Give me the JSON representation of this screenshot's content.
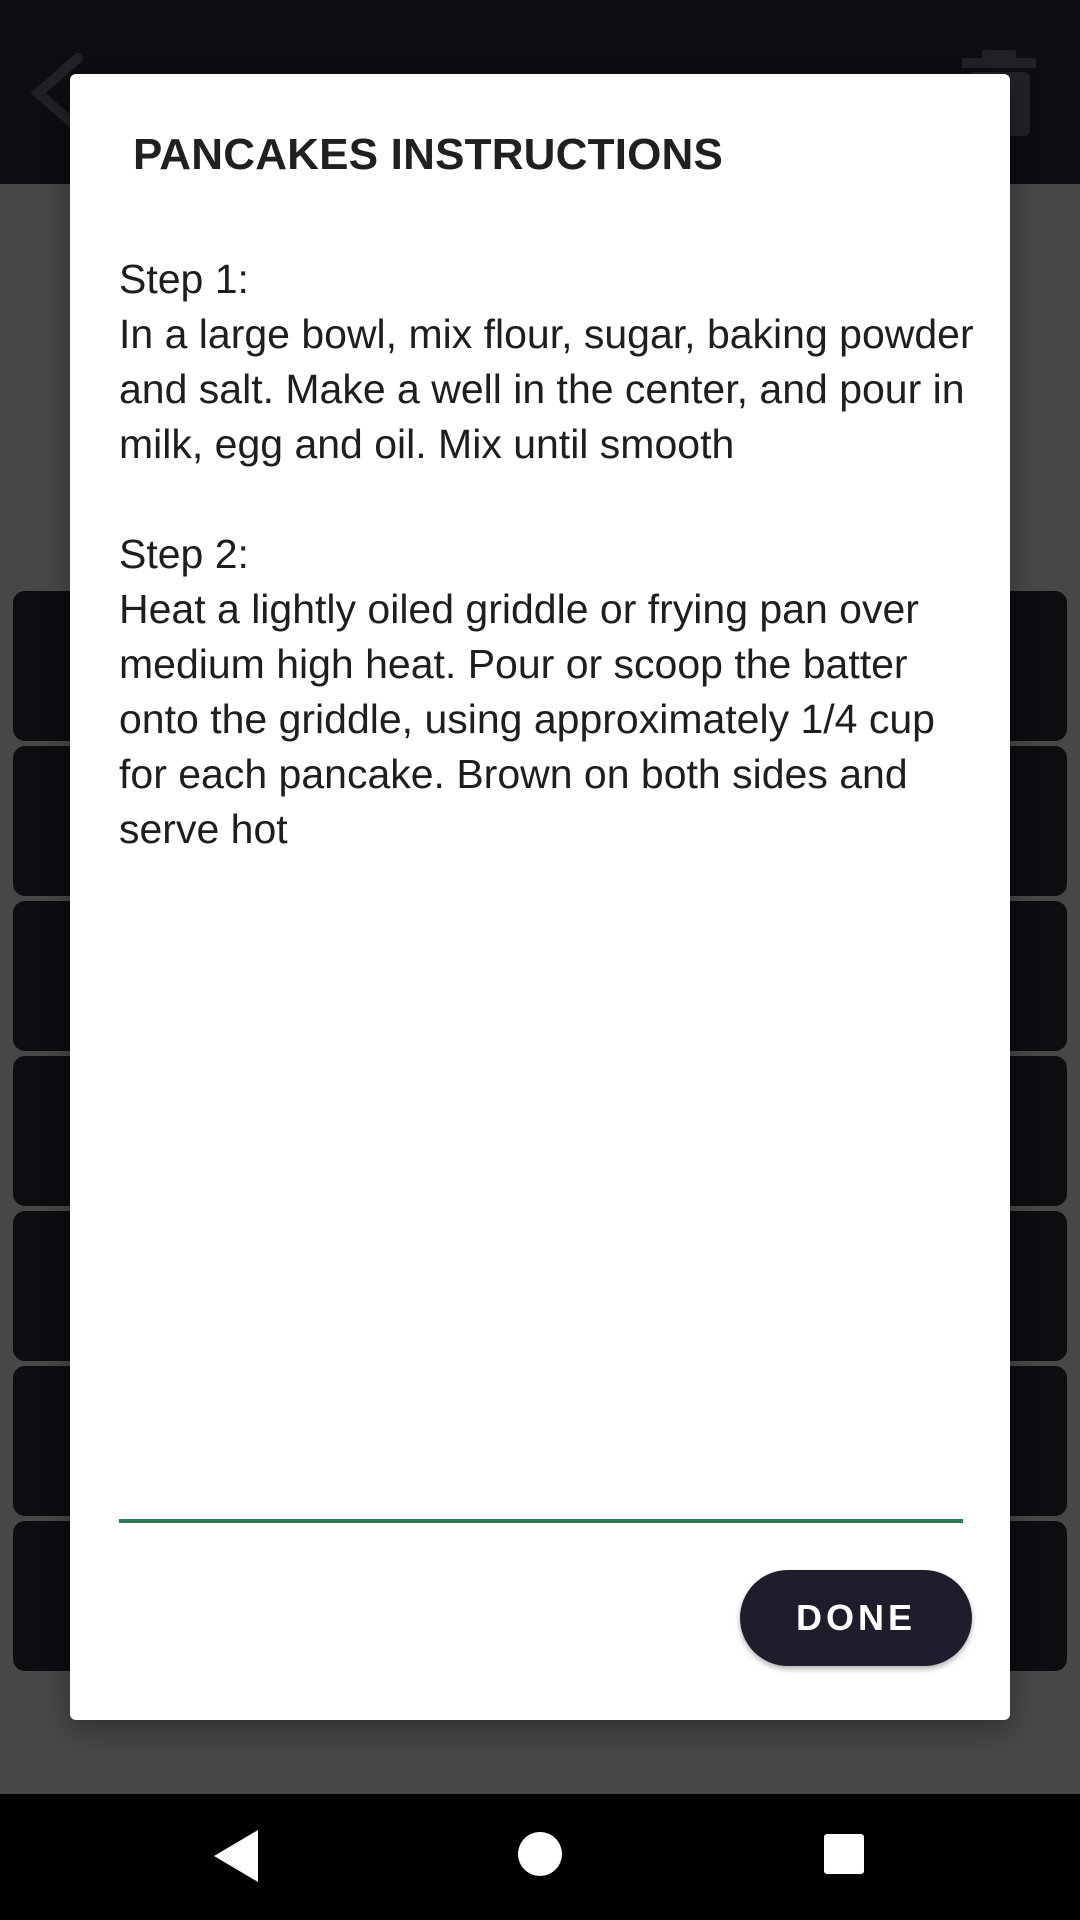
{
  "dialog": {
    "title": "PANCAKES INSTRUCTIONS",
    "instructions": "Step 1:\nIn a large bowl, mix flour, sugar, baking powder and salt. Make a well in the center, and pour in milk, egg and oil. Mix until smooth\n\nStep 2:\nHeat a lightly oiled griddle or frying pan over medium high heat. Pour or scoop the batter onto the griddle, using approximately 1/4 cup for each pancake. Brown on both sides and serve hot",
    "done_label": "DONE"
  },
  "colors": {
    "app_bar": "#181820",
    "accent_underline": "#2e7a5a",
    "done_button": "#1d1d2b"
  },
  "icons": {
    "back": "back-arrow-icon",
    "delete": "trash-icon",
    "nav_back": "nav-back-icon",
    "nav_home": "nav-home-icon",
    "nav_recents": "nav-recents-icon"
  }
}
